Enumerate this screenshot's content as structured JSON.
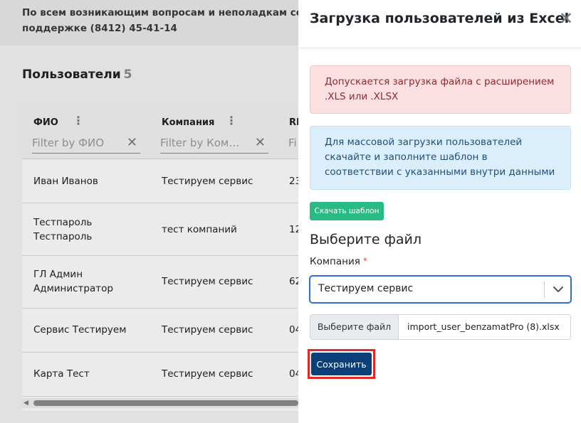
{
  "background": {
    "notice_line1": "По всем возникающим вопросам и неполадкам сообщайте",
    "notice_line2": "поддержке (8412) 45-41-14",
    "users_title": "Пользователи",
    "users_count": "5",
    "grid": {
      "columns": [
        {
          "label": "ФИО",
          "filter_placeholder": "Filter by ФИО"
        },
        {
          "label": "Компания",
          "filter_placeholder": "Filter by Компания"
        },
        {
          "label": "RI",
          "filter_placeholder": "Fi"
        }
      ],
      "rows": [
        {
          "fio": "Иван Иванов",
          "company": "Тестируем сервис",
          "third": "23"
        },
        {
          "fio": "Тестпароль\nТестпароль",
          "company": "тест компаний",
          "third": "12"
        },
        {
          "fio": "ГЛ Админ\nАдминистратор",
          "company": "Тестируем сервис",
          "third": "62"
        },
        {
          "fio": "Сервис Тестируем",
          "company": "Тестируем сервис",
          "third": "04"
        },
        {
          "fio": "Карта Тест",
          "company": "Тестируем сервис",
          "third": "04"
        }
      ]
    }
  },
  "panel": {
    "title": "Загрузка пользователей из Excel",
    "alert_danger": "Допускается загрузка файла с расширением .XLS или .XLSX",
    "alert_info": "Для массовой загрузки пользователей скачайте и заполните шаблон в соответствии с указанными внутри данными",
    "download_template_label": "Скачать шаблон",
    "section_title": "Выберите файл",
    "company_label": "Компания",
    "required_mark": "*",
    "company_value": "Тестируем сервис",
    "file_button_label": "Выберите файл",
    "file_name": "import_user_benzamatPro (8).xlsx",
    "save_label": "Сохранить"
  },
  "colors": {
    "primary_button": "#0b3f7a",
    "template_button": "#28bb84",
    "highlight": "#e02929",
    "select_focus": "#2d6fd6"
  }
}
